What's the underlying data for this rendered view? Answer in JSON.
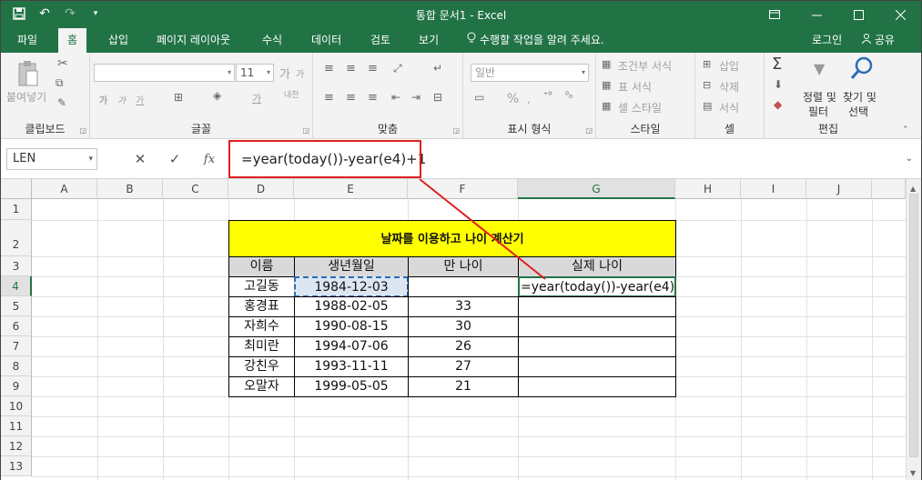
{
  "window": {
    "title": "통합 문서1 - Excel",
    "qat_icons": [
      "save-icon",
      "undo-icon",
      "redo-icon",
      "customize-icon"
    ],
    "controls": [
      "ribbon-display-icon",
      "minimize-icon",
      "maximize-icon",
      "close-icon"
    ]
  },
  "tabs": [
    {
      "label": "파일",
      "active": false
    },
    {
      "label": "홈",
      "active": true
    },
    {
      "label": "삽입",
      "active": false
    },
    {
      "label": "페이지 레이아웃",
      "active": false
    },
    {
      "label": "수식",
      "active": false
    },
    {
      "label": "데이터",
      "active": false
    },
    {
      "label": "검토",
      "active": false
    },
    {
      "label": "보기",
      "active": false
    }
  ],
  "tell_me": "수행할 작업을 알려 주세요.",
  "login": "로그인",
  "share": "공유",
  "ribbon": {
    "clipboard": {
      "paste": "붙여넣기",
      "label": "클립보드"
    },
    "font": {
      "font_size": "11",
      "label": "글꼴",
      "grow": "가",
      "shrink": "가",
      "bold": "가",
      "italic": "가",
      "underline": "가",
      "phonetic": "내천"
    },
    "alignment": {
      "label": "맞춤"
    },
    "number": {
      "format": "일반",
      "label": "표시 형식",
      "percent": "%"
    },
    "styles": {
      "conditional": "조건부 서식",
      "table": "표 서식",
      "cell": "셀 스타일",
      "label": "스타일"
    },
    "cells": {
      "insert": "삽입",
      "delete": "삭제",
      "format": "서식",
      "label": "셀"
    },
    "editing": {
      "sort_line1": "정렬 및",
      "sort_line2": "필터",
      "find_line1": "찾기 및",
      "find_line2": "선택",
      "label": "편집"
    }
  },
  "formula_bar": {
    "name_box": "LEN",
    "formula": "=year(today())-year(e4)+1"
  },
  "sheet": {
    "columns": [
      "A",
      "B",
      "C",
      "D",
      "E",
      "F",
      "G",
      "H",
      "I",
      "J"
    ],
    "rows": [
      "1",
      "2",
      "3",
      "4",
      "5",
      "6",
      "7",
      "8",
      "9",
      "10",
      "11",
      "12",
      "13"
    ],
    "title": "날짜를 이용하고 나이 계산기",
    "headers": [
      "이름",
      "생년월일",
      "만 나이",
      "실제 나이"
    ],
    "data": [
      {
        "name": "고길동",
        "birth": "1984-12-03",
        "age": "",
        "real": "=year(today())-year(e4)+1"
      },
      {
        "name": "홍경표",
        "birth": "1988-02-05",
        "age": "33",
        "real": ""
      },
      {
        "name": "자희수",
        "birth": "1990-08-15",
        "age": "30",
        "real": ""
      },
      {
        "name": "최미란",
        "birth": "1994-07-06",
        "age": "26",
        "real": ""
      },
      {
        "name": "강친우",
        "birth": "1993-11-11",
        "age": "27",
        "real": ""
      },
      {
        "name": "오말자",
        "birth": "1999-05-05",
        "age": "21",
        "real": ""
      }
    ]
  },
  "colors": {
    "excel_green": "#217346",
    "title_fill": "#ffff00",
    "header_fill": "#d9d9d9",
    "highlight": "#e02020"
  }
}
